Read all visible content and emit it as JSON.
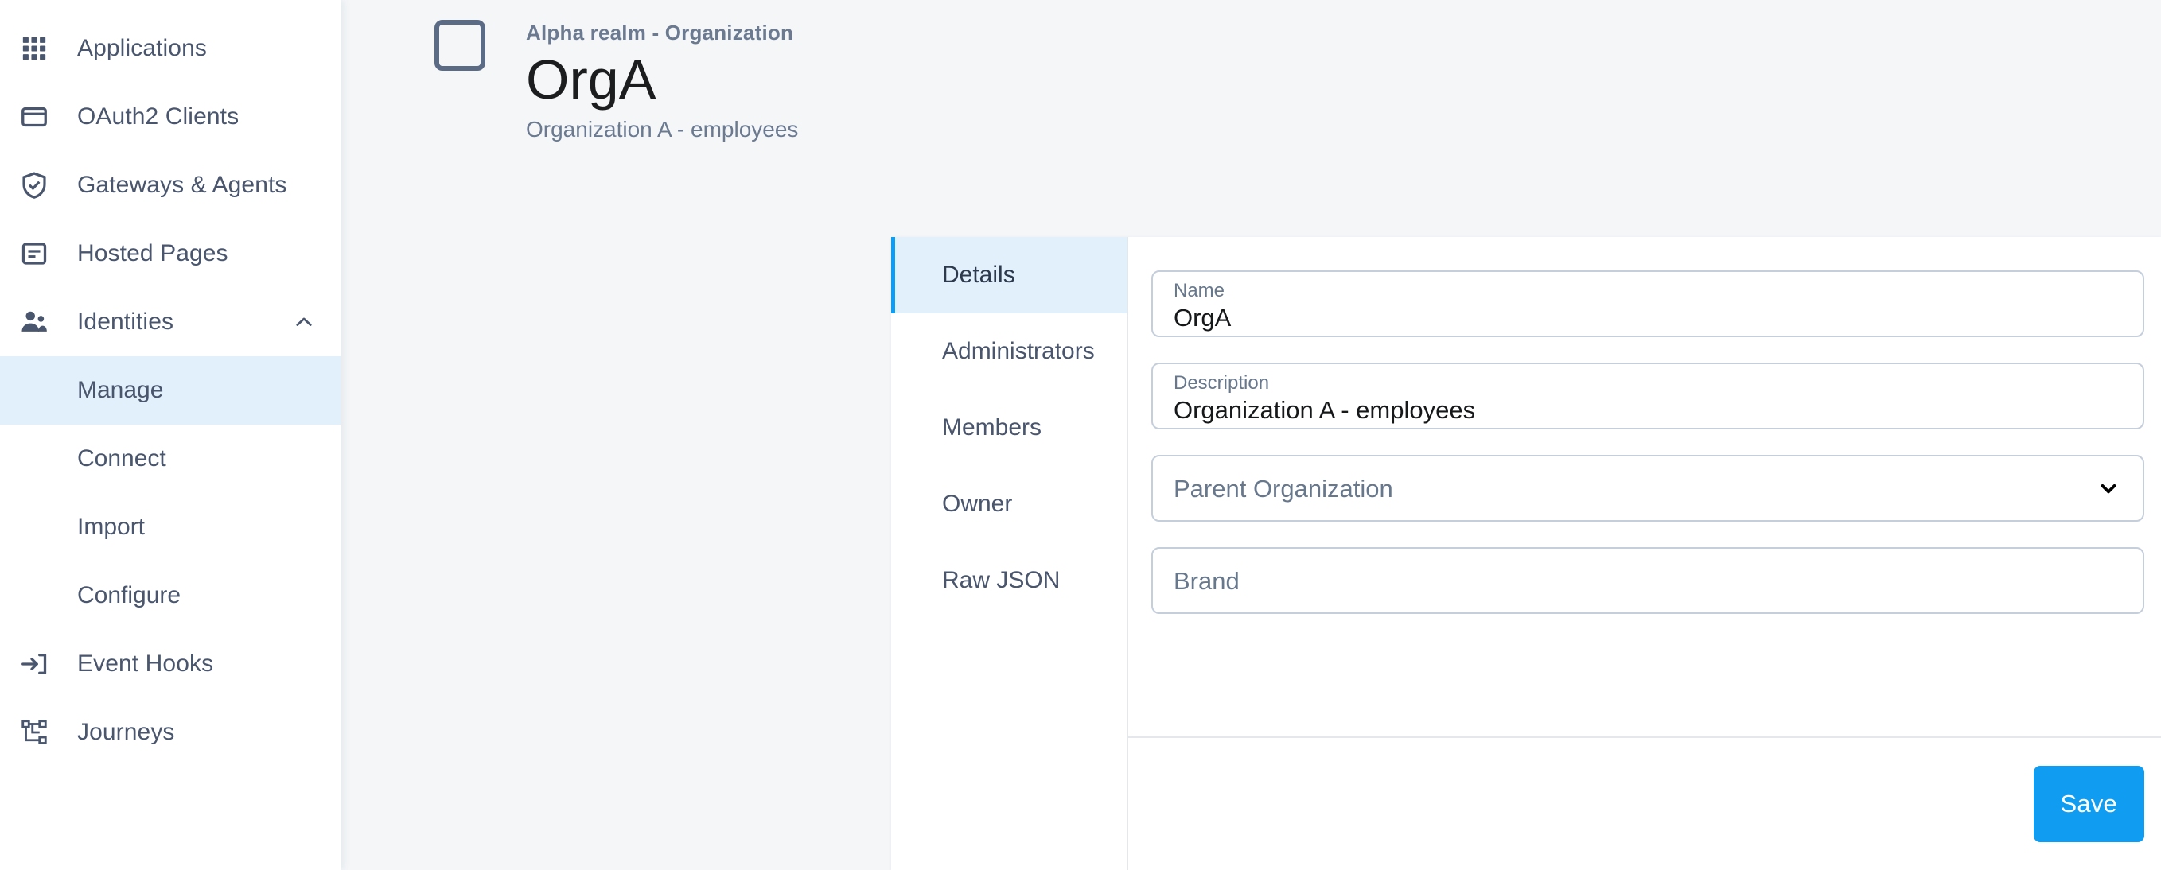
{
  "sidebar": {
    "items": [
      {
        "label": "Applications",
        "icon": "grid-icon",
        "type": "nav"
      },
      {
        "label": "OAuth2 Clients",
        "icon": "window-icon",
        "type": "nav"
      },
      {
        "label": "Gateways & Agents",
        "icon": "shield-check-icon",
        "type": "nav"
      },
      {
        "label": "Hosted Pages",
        "icon": "document-icon",
        "type": "nav"
      },
      {
        "label": "Identities",
        "icon": "people-icon",
        "type": "nav",
        "expanded": true,
        "chevron": "chevron-up-icon"
      }
    ],
    "identities_children": [
      {
        "label": "Manage",
        "active": true
      },
      {
        "label": "Connect",
        "active": false
      },
      {
        "label": "Import",
        "active": false
      },
      {
        "label": "Configure",
        "active": false
      }
    ],
    "items_after": [
      {
        "label": "Event Hooks",
        "icon": "login-arrow-icon",
        "type": "nav"
      },
      {
        "label": "Journeys",
        "icon": "sitemap-icon",
        "type": "nav"
      }
    ]
  },
  "header": {
    "avatar_icon": "organization-square-icon",
    "breadcrumb": "Alpha realm - Organization",
    "title": "OrgA",
    "subtitle": "Organization A - employees"
  },
  "tabs": [
    {
      "label": "Details",
      "active": true
    },
    {
      "label": "Administrators",
      "active": false
    },
    {
      "label": "Members",
      "active": false
    },
    {
      "label": "Owner",
      "active": false
    },
    {
      "label": "Raw JSON",
      "active": false
    }
  ],
  "form": {
    "name": {
      "label": "Name",
      "value": "OrgA"
    },
    "description": {
      "label": "Description",
      "value": "Organization A - employees"
    },
    "parent_organization": {
      "placeholder": "Parent Organization",
      "value": "",
      "icon": "chevron-down-icon"
    },
    "brand": {
      "placeholder": "Brand",
      "value": ""
    }
  },
  "footer": {
    "save_label": "Save"
  },
  "colors": {
    "accent": "#109cf1",
    "active_bg": "#e1f0fb",
    "page_bg": "#f4f6f8",
    "text": "#49566d",
    "muted": "#6b7a90",
    "border": "#c5cedb"
  }
}
